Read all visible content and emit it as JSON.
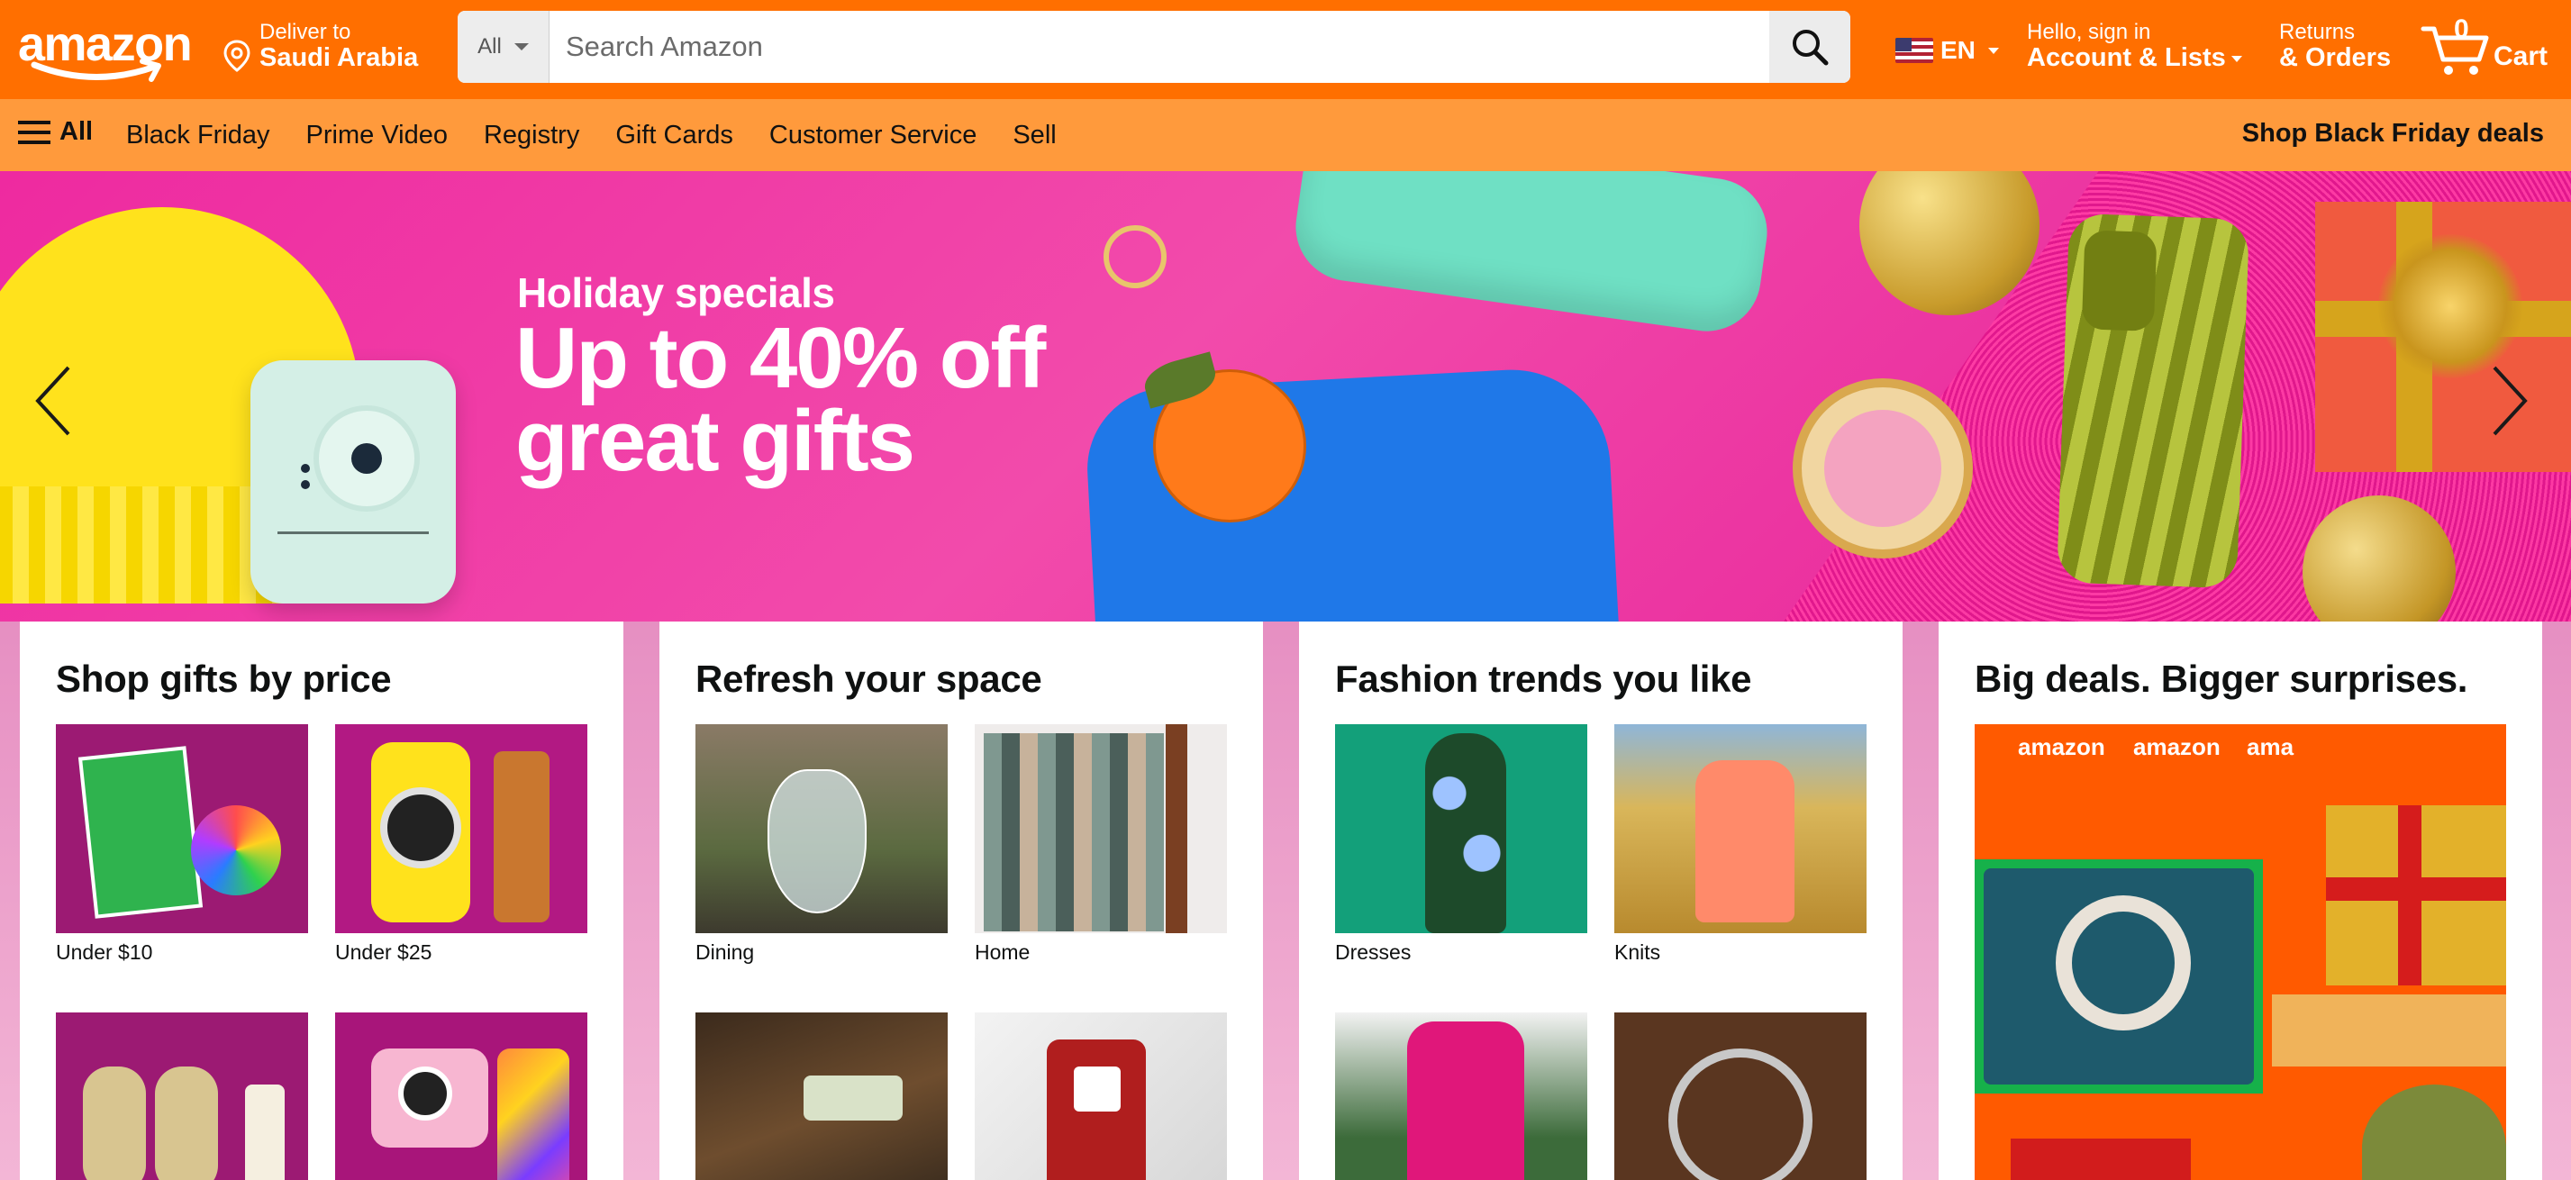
{
  "header": {
    "logo_text": "amazon",
    "deliver_line1": "Deliver to",
    "deliver_line2": "Saudi Arabia",
    "search_category": "All",
    "search_placeholder": "Search Amazon",
    "language": "EN",
    "account_line1": "Hello, sign in",
    "account_line2": "Account & Lists",
    "orders_line1": "Returns",
    "orders_line2": "& Orders",
    "cart_count": "0",
    "cart_label": "Cart",
    "colors": {
      "header_bg": "#ff6f00",
      "nav_bg": "#ff9a3c"
    }
  },
  "nav": {
    "all_label": "All",
    "links": [
      "Black Friday",
      "Prime Video",
      "Registry",
      "Gift Cards",
      "Customer Service",
      "Sell"
    ],
    "promo": "Shop Black Friday deals"
  },
  "hero": {
    "kicker": "Holiday specials",
    "headline": "Up to 40% off great gifts",
    "bg_color": "#ee2aa0"
  },
  "cards": [
    {
      "title": "Shop gifts by price",
      "tiles": [
        {
          "caption": "Under $10"
        },
        {
          "caption": "Under $25"
        },
        {
          "caption": ""
        },
        {
          "caption": ""
        }
      ]
    },
    {
      "title": "Refresh your space",
      "tiles": [
        {
          "caption": "Dining"
        },
        {
          "caption": "Home"
        },
        {
          "caption": ""
        },
        {
          "caption": ""
        }
      ]
    },
    {
      "title": "Fashion trends you like",
      "tiles": [
        {
          "caption": "Dresses"
        },
        {
          "caption": "Knits"
        },
        {
          "caption": ""
        },
        {
          "caption": ""
        }
      ]
    },
    {
      "title": "Big deals. Bigger surprises.",
      "image_text": [
        "amazon",
        "amazon",
        "ama"
      ]
    }
  ],
  "icons": [
    "location-pin-icon",
    "chevron-down-icon",
    "search-icon",
    "us-flag-icon",
    "cart-icon",
    "hamburger-menu-icon",
    "chevron-left-icon",
    "chevron-right-icon"
  ]
}
